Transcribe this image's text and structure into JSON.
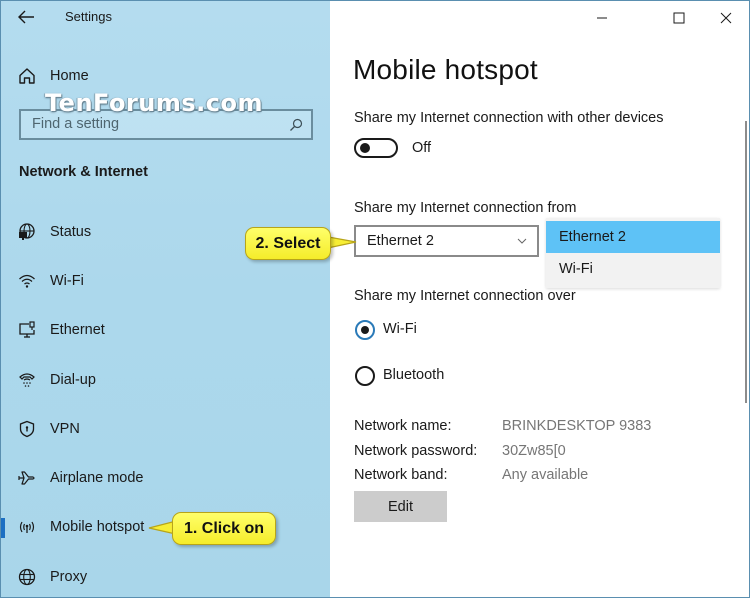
{
  "window": {
    "app_title": "Settings",
    "controls": {
      "minimize": "minimize",
      "maximize": "maximize",
      "close": "close"
    }
  },
  "watermark": "TenForums.com",
  "sidebar": {
    "home_label": "Home",
    "search_placeholder": "Find a setting",
    "section_title": "Network & Internet",
    "items": [
      {
        "label": "Status",
        "icon": "globe-monitor-icon",
        "selected": false
      },
      {
        "label": "Wi-Fi",
        "icon": "wifi-icon",
        "selected": false
      },
      {
        "label": "Ethernet",
        "icon": "ethernet-icon",
        "selected": false
      },
      {
        "label": "Dial-up",
        "icon": "dialup-icon",
        "selected": false
      },
      {
        "label": "VPN",
        "icon": "shield-icon",
        "selected": false
      },
      {
        "label": "Airplane mode",
        "icon": "airplane-icon",
        "selected": false
      },
      {
        "label": "Mobile hotspot",
        "icon": "hotspot-icon",
        "selected": true
      },
      {
        "label": "Proxy",
        "icon": "globe-icon",
        "selected": false
      }
    ]
  },
  "callouts": {
    "step1": "1. Click on",
    "step2": "2. Select"
  },
  "main": {
    "title": "Mobile hotspot",
    "share_label": "Share my Internet connection with other devices",
    "toggle_state": "Off",
    "from_label": "Share my Internet connection from",
    "from_selected": "Ethernet 2",
    "from_options": [
      "Ethernet 2",
      "Wi-Fi"
    ],
    "from_highlighted": "Ethernet 2",
    "over_label": "Share my Internet connection over",
    "over_options": [
      {
        "label": "Wi-Fi",
        "checked": true
      },
      {
        "label": "Bluetooth",
        "checked": false
      }
    ],
    "network_info": [
      {
        "key": "Network name:",
        "value": "BRINKDESKTOP 9383"
      },
      {
        "key": "Network password:",
        "value": "30Zw85[0"
      },
      {
        "key": "Network band:",
        "value": "Any available"
      }
    ],
    "edit_label": "Edit"
  },
  "colors": {
    "sidebar_bg": "#acd8ec",
    "selection_accent": "#1c6fc2",
    "dropdown_highlight": "#5ec2f6",
    "callout_yellow": "#f5ec2a",
    "edit_button": "#cccccc"
  }
}
